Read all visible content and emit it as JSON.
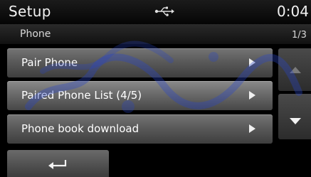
{
  "header": {
    "title": "Setup",
    "usb_icon": "usb-icon",
    "clock": "0:04"
  },
  "subheader": {
    "title": "Phone",
    "page": "1/3"
  },
  "menu": {
    "items": [
      {
        "label": "Pair Phone",
        "arrow_icon": "play-arrow-icon"
      },
      {
        "label": "Paired Phone List (4/5)",
        "arrow_icon": "play-arrow-icon"
      },
      {
        "label": "Phone book download",
        "arrow_icon": "play-arrow-icon"
      }
    ],
    "selected_index": 1
  },
  "scroll": {
    "up_icon": "triangle-up-icon",
    "down_icon": "triangle-down-icon"
  },
  "footer": {
    "back_icon": "return-arrow-icon"
  },
  "colors": {
    "background": "#000000",
    "button_gradient_top": "#747474",
    "button_gradient_bottom": "#3e3e3e",
    "text": "#ffffff"
  }
}
